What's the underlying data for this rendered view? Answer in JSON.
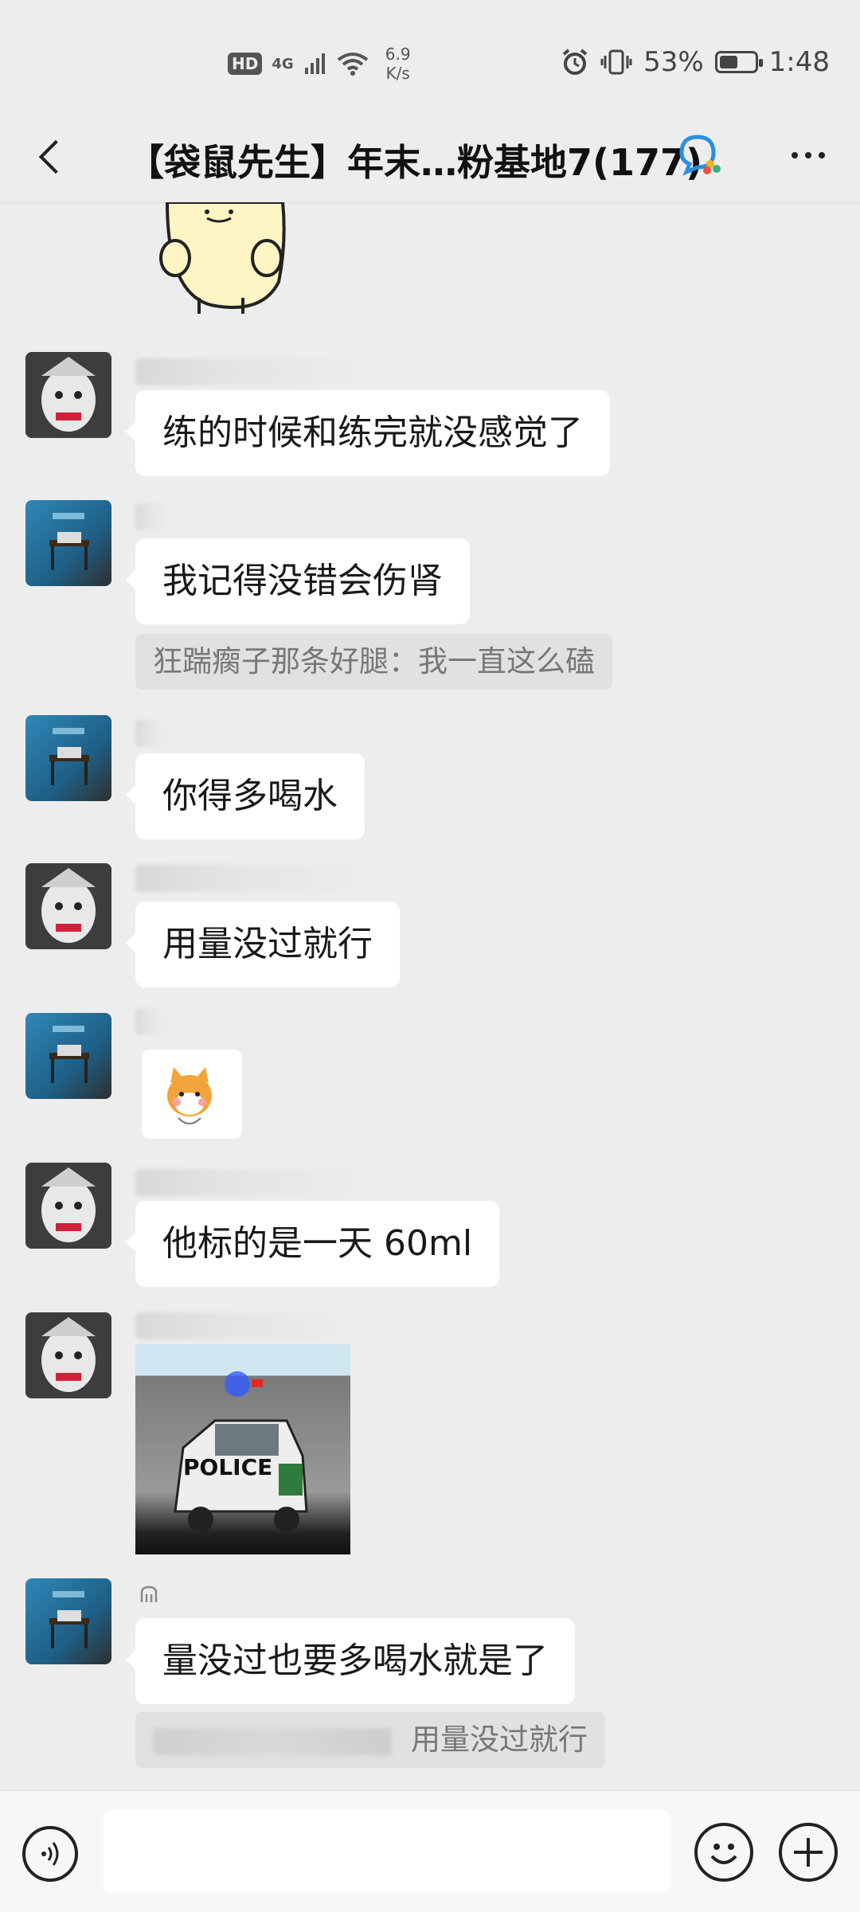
{
  "status_bar": {
    "hd": "HD",
    "network": "4G",
    "speed_value": "6.9",
    "speed_unit": "K/s",
    "battery": "53%",
    "battery_level": 0.53,
    "time": "1:48"
  },
  "header": {
    "title": "【袋鼠先生】年末…粉基地7(177)",
    "back_icon": "chevron-left-icon",
    "more_icon": "more-dots-icon",
    "group_icon": "group-chat-icon"
  },
  "messages": [
    {
      "text": "练的时候和练完就没感觉了"
    },
    {
      "text": "我记得没错会伤肾",
      "quote": "狂踹瘸子那条好腿：我一直这么磕"
    },
    {
      "text": "你得多喝水"
    },
    {
      "text": "用量没过就行"
    },
    {
      "sticker": "shiba-sticker"
    },
    {
      "text": "他标的是一天 60ml"
    },
    {
      "image_label": "POLICE"
    },
    {
      "text": "量没过也要多喝水就是了",
      "quote": "用量没过就行"
    }
  ],
  "input_bar": {
    "voice_icon": "voice-icon",
    "emoji_icon": "emoji-icon",
    "plus_icon": "plus-icon"
  }
}
